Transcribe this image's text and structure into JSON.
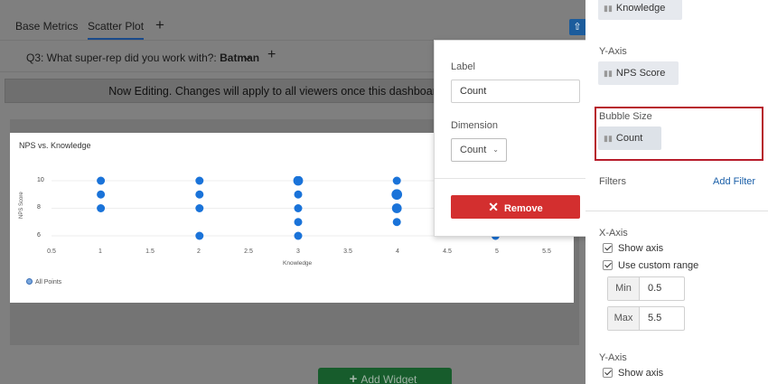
{
  "tabs": [
    {
      "label": "Base Metrics",
      "active": false
    },
    {
      "label": "Scatter Plot",
      "active": true
    }
  ],
  "tab_add": "+",
  "filter_bar": {
    "question": "Q3: What super-rep did you work with?:",
    "value": "Batman",
    "chevron": "⌄",
    "add": "+"
  },
  "notice": "Now Editing. Changes will apply to all viewers once this dashboard is published.",
  "widget": {
    "title": "NPS vs. Knowledge",
    "add_widget_label": "Add Widget"
  },
  "chart_data": {
    "type": "scatter",
    "title": "NPS vs. Knowledge",
    "xlabel": "Knowledge",
    "ylabel": "NPS Score",
    "xlim": [
      0.5,
      5.5
    ],
    "ylim": [
      5.5,
      10.5
    ],
    "x_ticks": [
      "0.5",
      "1",
      "1.5",
      "2",
      "2.5",
      "3",
      "3.5",
      "4",
      "4.5",
      "5",
      "5.5"
    ],
    "y_ticks": [
      "10",
      "8",
      "6"
    ],
    "series": [
      {
        "name": "All Points",
        "color": "#1a73d9",
        "points": [
          {
            "x": 1,
            "y": 10,
            "size": 1
          },
          {
            "x": 1,
            "y": 9,
            "size": 1
          },
          {
            "x": 1,
            "y": 8,
            "size": 1
          },
          {
            "x": 2,
            "y": 10,
            "size": 1
          },
          {
            "x": 2,
            "y": 9,
            "size": 1
          },
          {
            "x": 2,
            "y": 8,
            "size": 1
          },
          {
            "x": 2,
            "y": 6,
            "size": 1
          },
          {
            "x": 3,
            "y": 10,
            "size": 1.2
          },
          {
            "x": 3,
            "y": 9,
            "size": 1
          },
          {
            "x": 3,
            "y": 8,
            "size": 1
          },
          {
            "x": 3,
            "y": 7,
            "size": 1
          },
          {
            "x": 3,
            "y": 6,
            "size": 1
          },
          {
            "x": 4,
            "y": 10,
            "size": 1
          },
          {
            "x": 4,
            "y": 9,
            "size": 1.3
          },
          {
            "x": 4,
            "y": 8,
            "size": 1.2
          },
          {
            "x": 4,
            "y": 7,
            "size": 1
          },
          {
            "x": 5,
            "y": 6,
            "size": 1
          }
        ]
      }
    ],
    "legend": "bottom-left"
  },
  "popover": {
    "label_caption": "Label",
    "label_value": "Count",
    "dimension_caption": "Dimension",
    "dimension_value": "Count",
    "remove_label": "Remove"
  },
  "panel": {
    "x_field": "Knowledge",
    "y_axis_caption": "Y-Axis",
    "y_field": "NPS Score",
    "bubble_caption": "Bubble Size",
    "bubble_field": "Count",
    "filters_caption": "Filters",
    "add_filter": "Add Filter",
    "x_axis_caption": "X-Axis",
    "show_axis": "Show axis",
    "use_custom_range": "Use custom range",
    "min_label": "Min",
    "min_value": "0.5",
    "max_label": "Max",
    "max_value": "5.5",
    "y_axis_caption2": "Y-Axis",
    "show_axis2": "Show axis"
  },
  "colors": {
    "accent": "#1c5c9c",
    "remove": "#d32f2f",
    "highlight": "#b71c2b",
    "add_widget": "#175c2c"
  }
}
